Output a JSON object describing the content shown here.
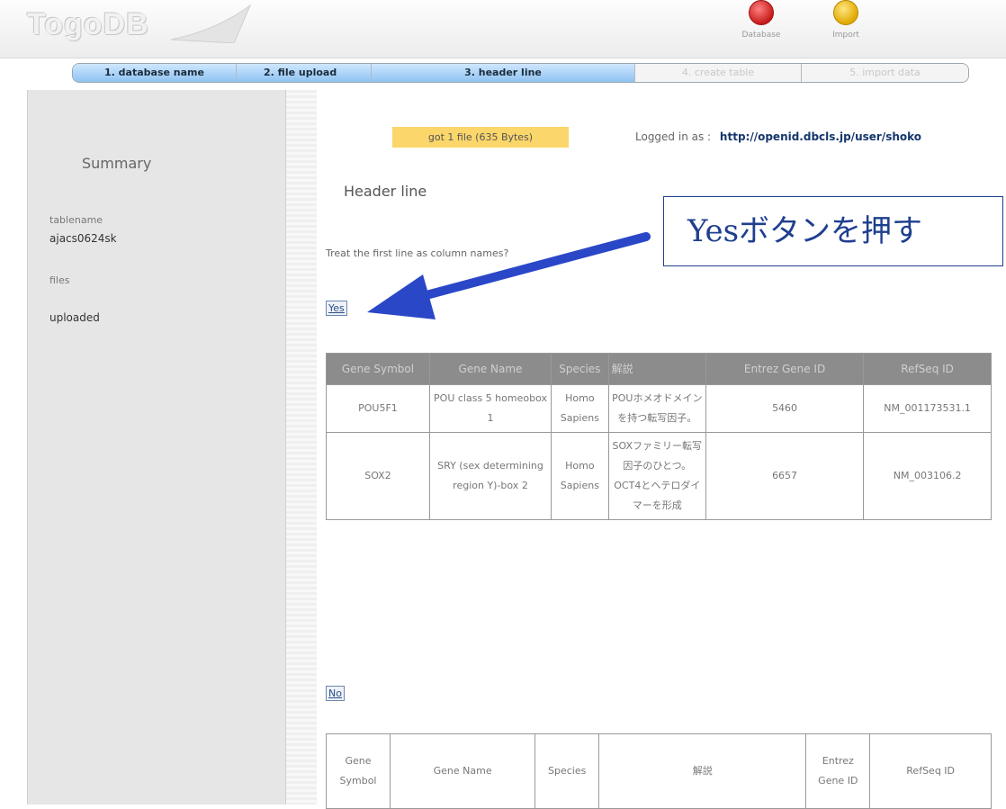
{
  "header": {
    "logo_text": "TogoDB",
    "tools": [
      {
        "label": "Database",
        "icon": "database-red-icon"
      },
      {
        "label": "Import",
        "icon": "import-yellow-icon"
      }
    ]
  },
  "steps": [
    {
      "label": "1. database name",
      "state": "active"
    },
    {
      "label": "2. file upload",
      "state": "active"
    },
    {
      "label": "3. header line",
      "state": "active"
    },
    {
      "label": "4. create table",
      "state": "inactive"
    },
    {
      "label": "5. import data",
      "state": "inactive"
    }
  ],
  "sidebar": {
    "title": "Summary",
    "tablename_label": "tablename",
    "tablename_value": "ajacs0624sk",
    "files_label": "files",
    "files_value": "uploaded"
  },
  "main": {
    "file_badge": "got 1 file (635 Bytes)",
    "logged_in_label": "Logged in as :",
    "logged_in_user": "http://openid.dbcls.jp/user/shoko",
    "section_title": "Header line",
    "question": "Treat the first line as column names?",
    "yes_label": "Yes",
    "no_label": "No"
  },
  "annotation": {
    "text": "Yesボタンを押す",
    "color": "#1f3f8f"
  },
  "table_yes": {
    "headers": [
      "Gene Symbol",
      "Gene Name",
      "Species",
      "解説",
      "Entrez Gene ID",
      "RefSeq ID"
    ],
    "rows": [
      [
        "POU5F1",
        "POU class 5 homeobox 1",
        "Homo Sapiens",
        "POUホメオドメインを持つ転写因子。",
        "5460",
        "NM_001173531.1"
      ],
      [
        "SOX2",
        "SRY (sex determining region Y)-box 2",
        "Homo Sapiens",
        "SOXファミリー転写因子のひとつ。OCT4とヘテロダイマーを形成",
        "6657",
        "NM_003106.2"
      ]
    ]
  },
  "table_no": {
    "row": [
      "Gene Symbol",
      "Gene Name",
      "Species",
      "解説",
      "Entrez Gene ID",
      "RefSeq ID"
    ]
  }
}
